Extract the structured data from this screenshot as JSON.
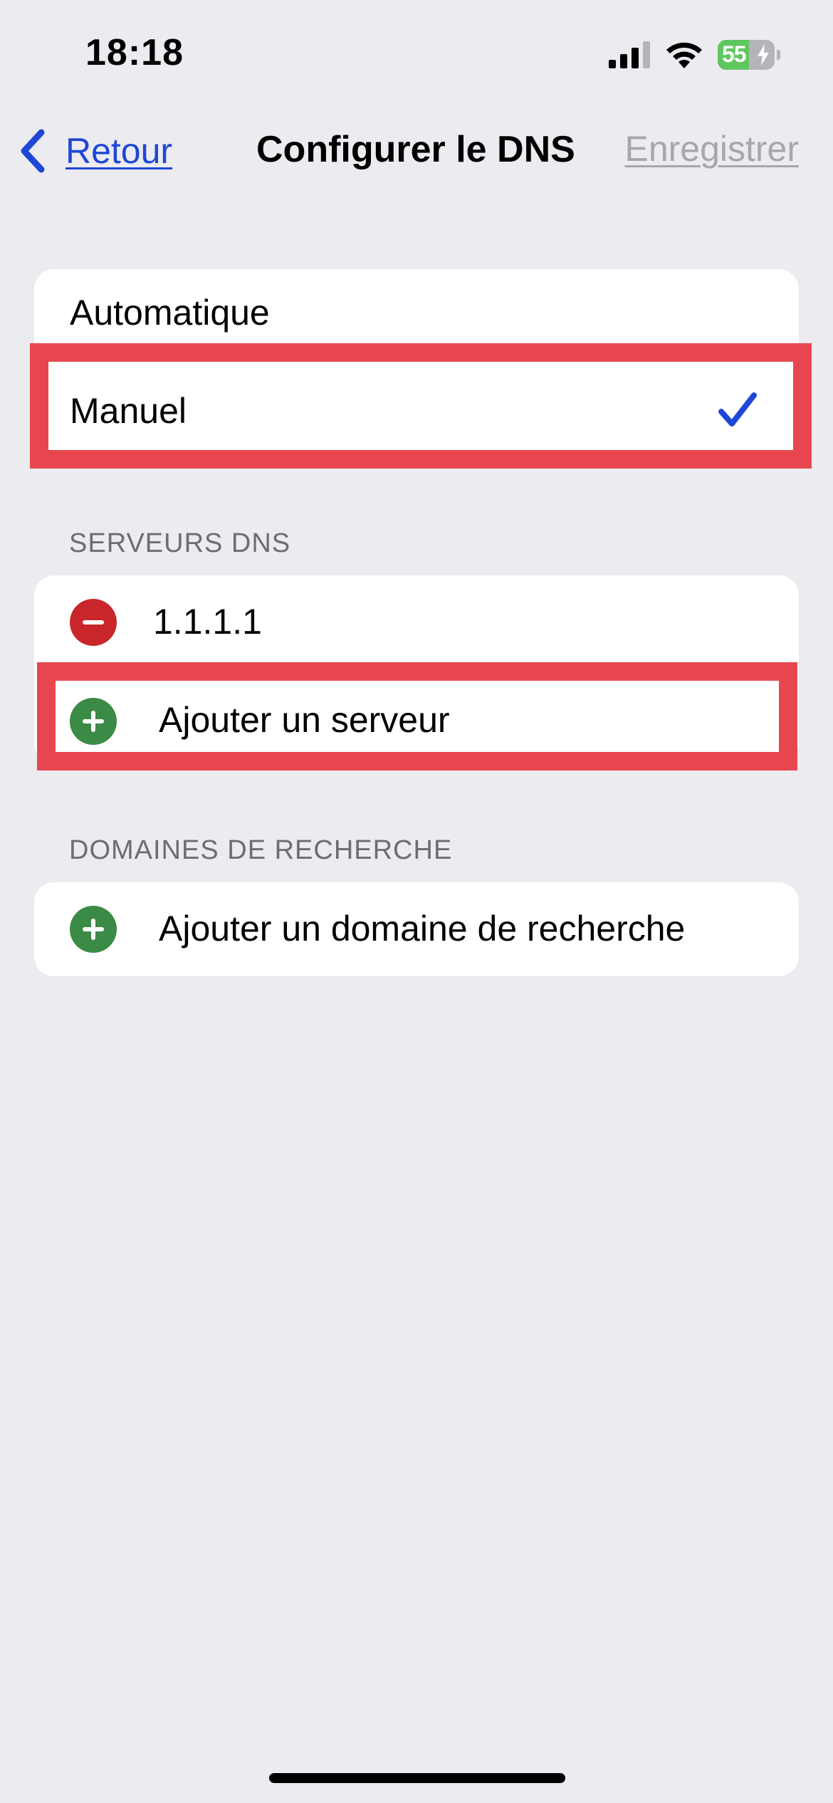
{
  "status_bar": {
    "time": "18:18",
    "battery_level": "55",
    "battery_fraction": 0.55,
    "battery_charging": true,
    "icons": [
      "signal-icon",
      "wifi-icon",
      "battery-icon",
      "bolt-icon"
    ]
  },
  "nav": {
    "back_label": "Retour",
    "title": "Configurer le DNS",
    "save_label": "Enregistrer"
  },
  "mode": {
    "options": [
      {
        "label": "Automatique",
        "selected": false
      },
      {
        "label": "Manuel",
        "selected": true
      }
    ]
  },
  "dns_servers": {
    "header": "SERVEURS DNS",
    "servers": [
      "1.1.1.1"
    ],
    "add_label": "Ajouter un serveur"
  },
  "search_domains": {
    "header": "DOMAINES DE RECHERCHE",
    "add_label": "Ajouter un domaine de recherche"
  },
  "colors": {
    "background": "#ebebf0",
    "accent": "#1f47d6",
    "disabled": "#a6a6ab",
    "remove": "#c8262a",
    "add": "#3b8a45",
    "highlight": "#e8464e",
    "battery_fill": "#5fc75f"
  }
}
